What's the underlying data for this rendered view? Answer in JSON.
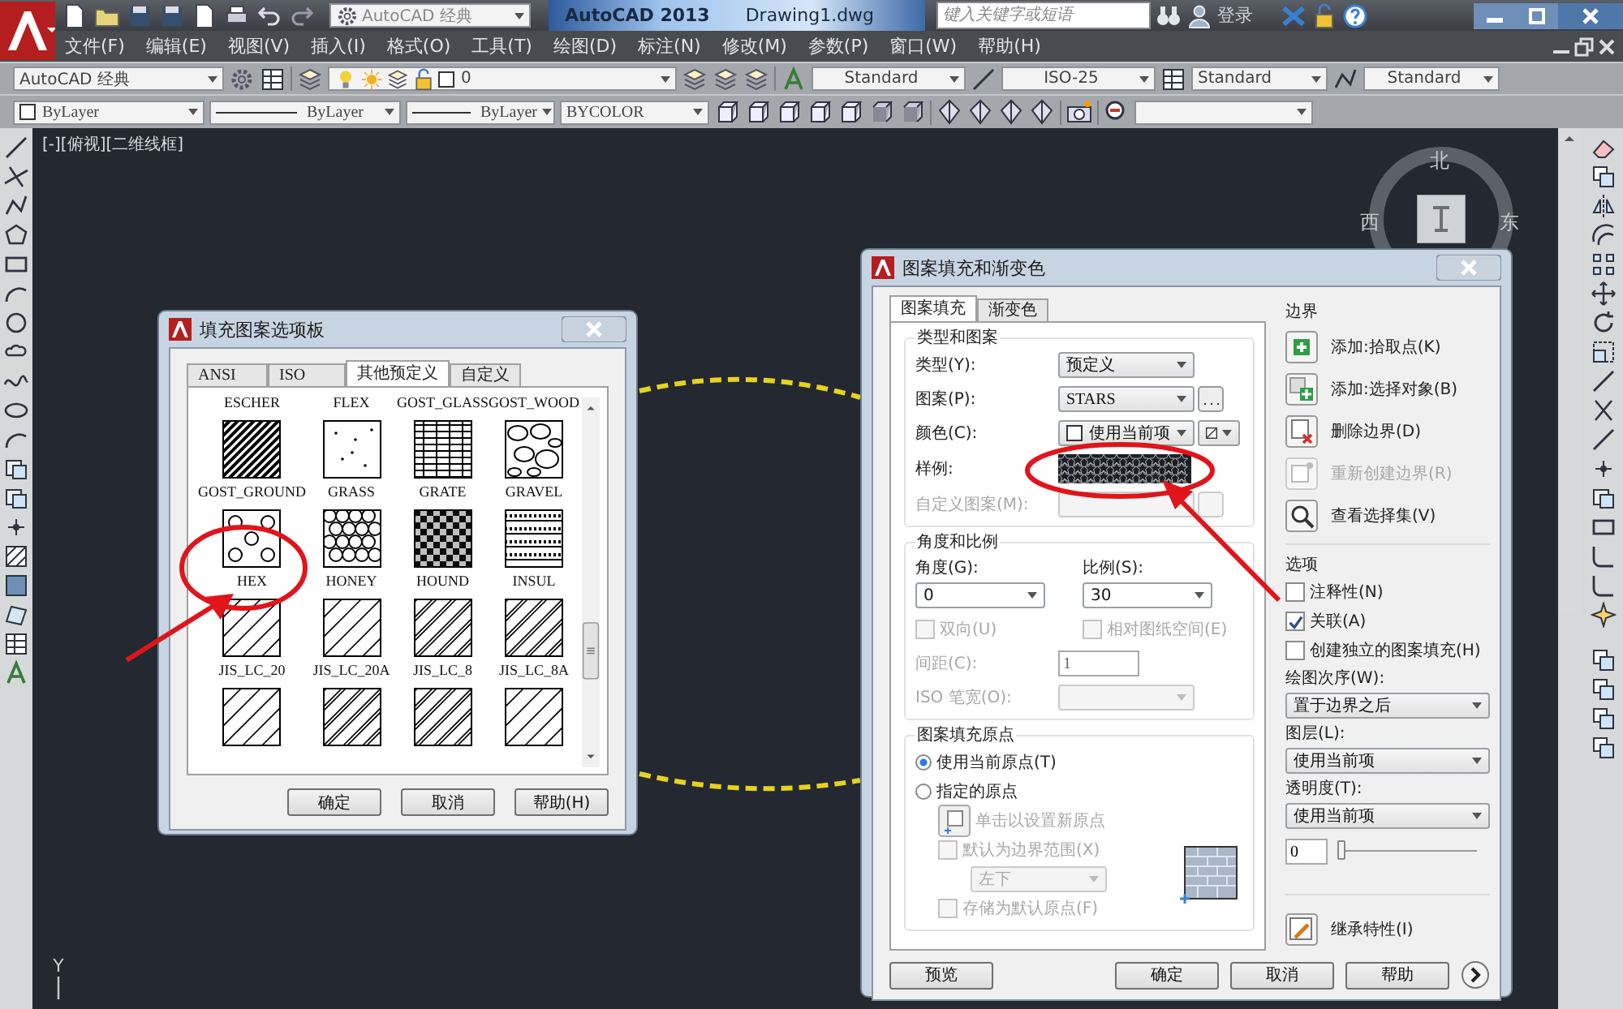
{
  "title_bar": {
    "workspace": "AutoCAD 经典",
    "app_title": "AutoCAD 2013",
    "file_name": "Drawing1.dwg",
    "search": {
      "placeholder": "键入关键字或短语"
    },
    "sign_in": "登录"
  },
  "menu": [
    "文件(F)",
    "编辑(E)",
    "视图(V)",
    "插入(I)",
    "格式(O)",
    "工具(T)",
    "绘图(D)",
    "标注(N)",
    "修改(M)",
    "参数(P)",
    "窗口(W)",
    "帮助(H)"
  ],
  "toolbar_1": {
    "workspace": "AutoCAD 经典",
    "layer": "0",
    "text_style": "Standard",
    "dim_style": "ISO-25",
    "table_style": "Standard",
    "multileader_style": "Standard"
  },
  "toolbar_2": {
    "color_setting": "ByLayer",
    "linetype": "ByLayer",
    "lineweight": "ByLayer",
    "plot_style": "BYCOLOR"
  },
  "viewport_label": "[-][俯视][二维线框]",
  "viewcube": {
    "north": "北",
    "west": "西",
    "east": "东"
  },
  "ucs_label": "Y",
  "palette_dialog": {
    "title": "填充图案选项板",
    "tabs": [
      {
        "label": "ANSI",
        "selected": false
      },
      {
        "label": "ISO",
        "selected": false
      },
      {
        "label": "其他预定义",
        "selected": true
      },
      {
        "label": "自定义",
        "selected": false
      }
    ],
    "patterns": [
      {
        "label": "ESCHER",
        "kind": "hidden"
      },
      {
        "label": "FLEX",
        "kind": "hidden"
      },
      {
        "label": "GOST_GLASS",
        "kind": "hidden"
      },
      {
        "label": "GOST_WOOD",
        "kind": "hidden"
      },
      {
        "label": "GOST_GROUND",
        "kind": "dense_diagonal"
      },
      {
        "label": "GRASS",
        "kind": "dots"
      },
      {
        "label": "GRATE",
        "kind": "grid"
      },
      {
        "label": "GRAVEL",
        "kind": "stones"
      },
      {
        "label": "HEX",
        "kind": "hex_circles"
      },
      {
        "label": "HONEY",
        "kind": "honeycomb"
      },
      {
        "label": "HOUND",
        "kind": "houndstooth"
      },
      {
        "label": "INSUL",
        "kind": "insulation"
      },
      {
        "label": "JIS_LC_20",
        "kind": "diagonal"
      },
      {
        "label": "JIS_LC_20A",
        "kind": "diagonal"
      },
      {
        "label": "JIS_LC_8",
        "kind": "double_diagonal"
      },
      {
        "label": "JIS_LC_8A",
        "kind": "double_diagonal"
      },
      {
        "kind": "diagonal"
      },
      {
        "kind": "double_diagonal"
      },
      {
        "kind": "double_diagonal"
      },
      {
        "kind": "diagonal"
      }
    ],
    "buttons": [
      "确定",
      "取消",
      "帮助(H)"
    ]
  },
  "hatch_dialog": {
    "title": "图案填充和渐变色",
    "tabs": [
      {
        "label": "图案填充",
        "selected": true
      },
      {
        "label": "渐变色",
        "selected": false
      }
    ],
    "type_pattern": {
      "heading": "类型和图案",
      "fields": [
        {
          "kind": "dropdown",
          "label": "类型(Y):",
          "value": "预定义",
          "disabled": false
        },
        {
          "kind": "dropdown_browse",
          "label": "图案(P):",
          "value": "STARS",
          "disabled": false
        },
        {
          "kind": "color",
          "label": "颜色(C):",
          "value": "使用当前项",
          "disabled": false
        },
        {
          "kind": "swatch",
          "label": "样例:",
          "disabled": false
        },
        {
          "kind": "browse",
          "label": "自定义图案(M):",
          "disabled": true
        }
      ]
    },
    "angle_scale": {
      "heading": "角度和比例",
      "angle": {
        "label": "角度(G):",
        "value": "0"
      },
      "scale": {
        "label": "比例(S):",
        "value": "30"
      },
      "checkboxes": [
        {
          "label": "双向(U)",
          "checked": false,
          "disabled": true
        },
        {
          "label": "相对图纸空间(E)",
          "checked": false,
          "disabled": true
        }
      ],
      "spacing": {
        "label": "间距(C):",
        "value": "1",
        "disabled": true
      },
      "pen_width": {
        "label": "ISO 笔宽(O):",
        "disabled": true
      }
    },
    "origin": {
      "heading": "图案填充原点",
      "radios": [
        {
          "label": "使用当前原点(T)",
          "selected": true
        },
        {
          "label": "指定的原点",
          "selected": false
        }
      ],
      "set_origin": {
        "label": "单击以设置新原点",
        "disabled": true
      },
      "default_extents": {
        "label": "默认为边界范围(X)",
        "checked": false,
        "disabled": true
      },
      "position": {
        "value": "左下",
        "disabled": true
      },
      "store_default": {
        "label": "存储为默认原点(F)",
        "checked": false,
        "disabled": true
      }
    },
    "boundaries": {
      "heading": "边界",
      "buttons": [
        {
          "kind": "pick_points",
          "label": "添加:拾取点(K)",
          "disabled": false
        },
        {
          "kind": "select_objects",
          "label": "添加:选择对象(B)",
          "disabled": false
        },
        {
          "kind": "remove",
          "label": "删除边界(D)",
          "disabled": false
        },
        {
          "kind": "recreate",
          "label": "重新创建边界(R)",
          "disabled": true
        },
        {
          "kind": "view",
          "label": "查看选择集(V)",
          "disabled": false
        }
      ]
    },
    "options": {
      "heading": "选项",
      "checkboxes": [
        {
          "label": "注释性(N)",
          "checked": false
        },
        {
          "label": "关联(A)",
          "checked": true
        },
        {
          "label": "创建独立的图案填充(H)",
          "checked": false
        }
      ],
      "draw_order": {
        "label": "绘图次序(W):",
        "value": "置于边界之后"
      },
      "layer": {
        "label": "图层(L):",
        "value": "使用当前项"
      },
      "transparency": {
        "label": "透明度(T):",
        "value": "使用当前项"
      },
      "transparency_slider": {
        "value": "0",
        "level": 0
      }
    },
    "inherit": "继承特性(I)",
    "buttons": [
      "预览",
      "确定",
      "取消",
      "帮助"
    ]
  }
}
